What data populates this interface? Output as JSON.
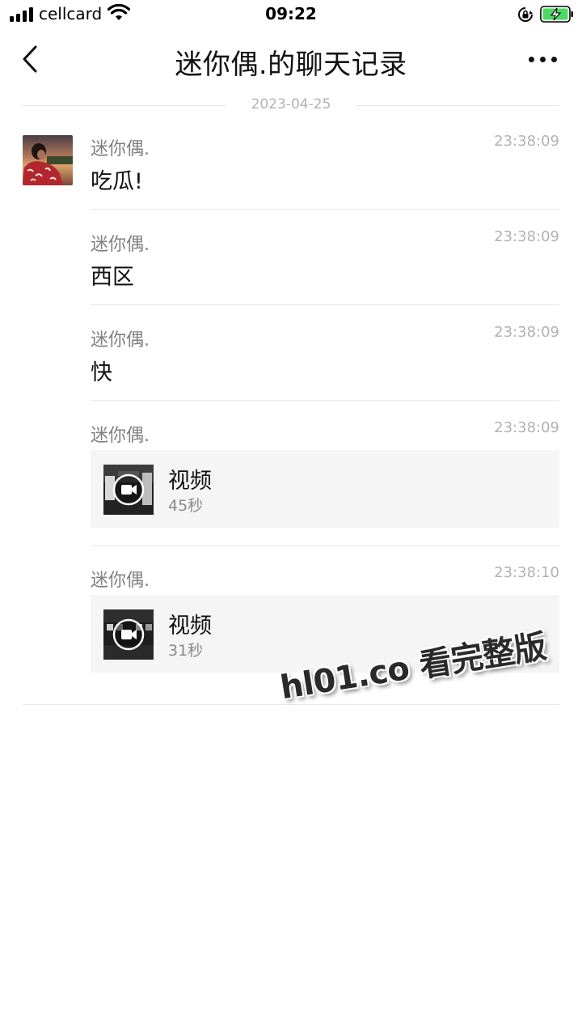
{
  "status_bar": {
    "carrier": "cellcard",
    "time": "09:22",
    "icons": [
      "signal-icon",
      "wifi-icon",
      "rotation-lock-icon",
      "battery-charging-icon"
    ],
    "battery_color": "#4cd964"
  },
  "nav": {
    "title": "迷你偶.的聊天记录",
    "back_icon": "chevron-left-icon",
    "more_icon": "more-dots-icon"
  },
  "date_divider": "2023-04-25",
  "messages": [
    {
      "sender": "迷你偶.",
      "time": "23:38:09",
      "type": "text",
      "text": "吃瓜!"
    },
    {
      "sender": "迷你偶.",
      "time": "23:38:09",
      "type": "text",
      "text": "西区"
    },
    {
      "sender": "迷你偶.",
      "time": "23:38:09",
      "type": "text",
      "text": "快"
    },
    {
      "sender": "迷你偶.",
      "time": "23:38:09",
      "type": "video",
      "title": "视频",
      "duration": "45秒"
    },
    {
      "sender": "迷你偶.",
      "time": "23:38:10",
      "type": "video",
      "title": "视频",
      "duration": "31秒"
    }
  ],
  "watermark": "hl01.co 看完整版",
  "colors": {
    "secondary_text": "#808080",
    "time_text": "#b2b2b2",
    "card_bg": "#f5f5f5"
  }
}
